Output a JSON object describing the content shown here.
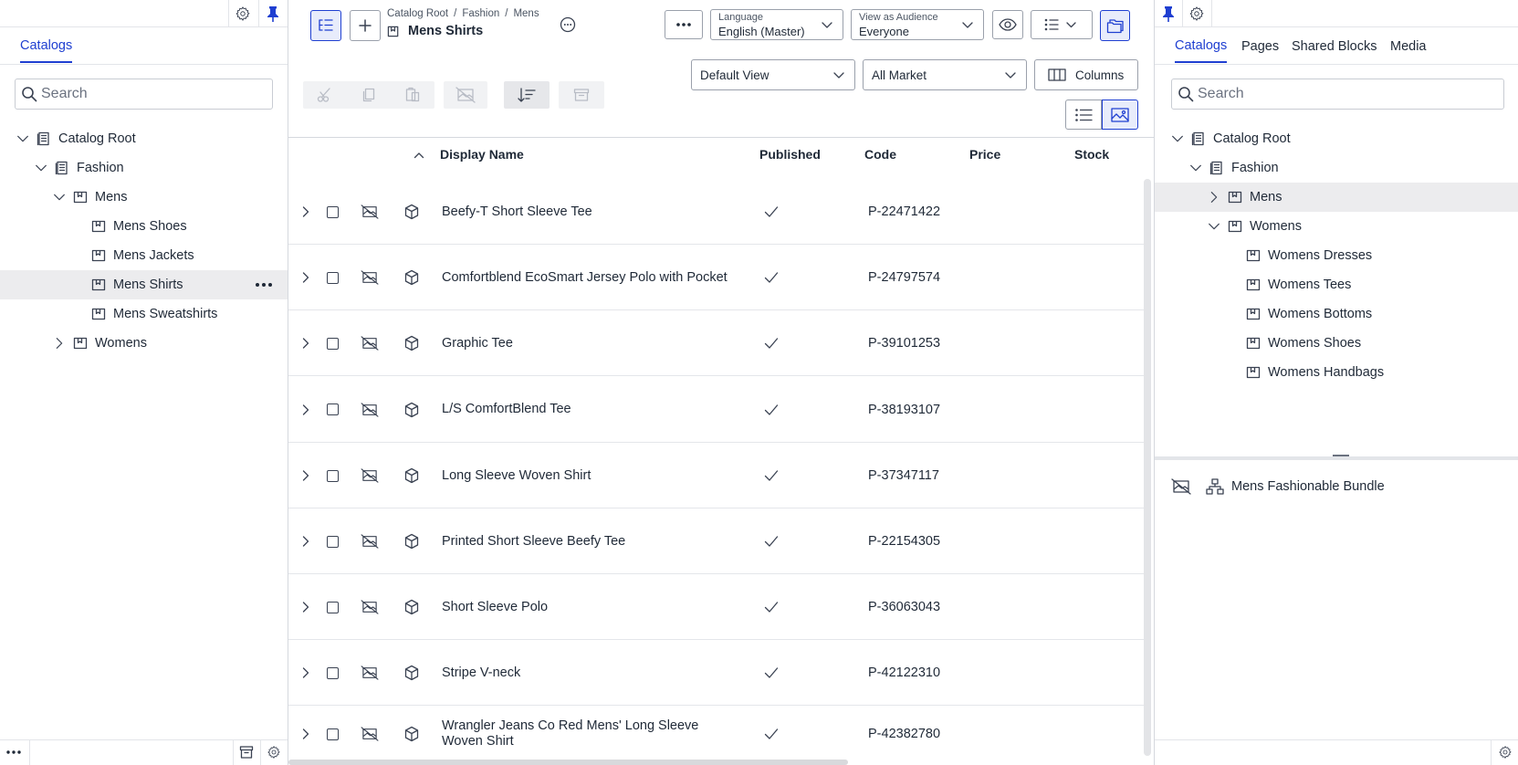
{
  "left_panel": {
    "tab": "Catalogs",
    "search_placeholder": "Search",
    "tree": [
      {
        "label": "Catalog Root",
        "type": "catalog",
        "expanded": true
      },
      {
        "label": "Fashion",
        "type": "catalog",
        "expanded": true
      },
      {
        "label": "Mens",
        "type": "folder",
        "expanded": true
      },
      {
        "label": "Mens Shoes",
        "type": "folder"
      },
      {
        "label": "Mens Jackets",
        "type": "folder"
      },
      {
        "label": "Mens Shirts",
        "type": "folder",
        "selected": true
      },
      {
        "label": "Mens Sweatshirts",
        "type": "folder"
      },
      {
        "label": "Womens",
        "type": "folder",
        "expanded": false
      }
    ]
  },
  "center": {
    "breadcrumb": [
      "Catalog Root",
      "Fashion",
      "Mens"
    ],
    "breadcrumb_sep": "/",
    "title": "Mens Shirts",
    "language": {
      "label": "Language",
      "value": "English (Master)"
    },
    "audience": {
      "label": "View as Audience",
      "value": "Everyone"
    },
    "view_select": "Default View",
    "market_select": "All Market",
    "columns_button": "Columns",
    "columns": {
      "display_name": "Display Name",
      "published": "Published",
      "code": "Code",
      "price": "Price",
      "stock": "Stock"
    },
    "rows": [
      {
        "name": "Beefy-T Short Sleeve Tee",
        "code": "P-22471422",
        "published": true
      },
      {
        "name": "Comfortblend EcoSmart Jersey Polo with Pocket",
        "code": "P-24797574",
        "published": true
      },
      {
        "name": "Graphic Tee",
        "code": "P-39101253",
        "published": true
      },
      {
        "name": "L/S ComfortBlend Tee",
        "code": "P-38193107",
        "published": true
      },
      {
        "name": "Long Sleeve Woven Shirt",
        "code": "P-37347117",
        "published": true
      },
      {
        "name": "Printed Short Sleeve Beefy Tee",
        "code": "P-22154305",
        "published": true
      },
      {
        "name": "Short Sleeve Polo",
        "code": "P-36063043",
        "published": true
      },
      {
        "name": "Stripe V-neck",
        "code": "P-42122310",
        "published": true
      },
      {
        "name": "Wrangler Jeans Co Red Mens' Long Sleeve Woven Shirt",
        "code": "P-42382780",
        "published": true
      }
    ]
  },
  "right_panel": {
    "tabs": [
      "Catalogs",
      "Pages",
      "Shared Blocks",
      "Media"
    ],
    "search_placeholder": "Search",
    "tree": [
      {
        "label": "Catalog Root",
        "type": "catalog",
        "expanded": true
      },
      {
        "label": "Fashion",
        "type": "catalog",
        "expanded": true
      },
      {
        "label": "Mens",
        "type": "folder",
        "expanded": false,
        "highlighted": true
      },
      {
        "label": "Womens",
        "type": "folder",
        "expanded": true
      },
      {
        "label": "Womens Dresses",
        "type": "folder"
      },
      {
        "label": "Womens Tees",
        "type": "folder"
      },
      {
        "label": "Womens Bottoms",
        "type": "folder"
      },
      {
        "label": "Womens Shoes",
        "type": "folder"
      },
      {
        "label": "Womens Handbags",
        "type": "folder"
      }
    ],
    "bundle": "Mens Fashionable Bundle"
  },
  "colors": {
    "accent": "#1f3fd1",
    "selected_row": "#ececee",
    "text": "#1f2937"
  }
}
